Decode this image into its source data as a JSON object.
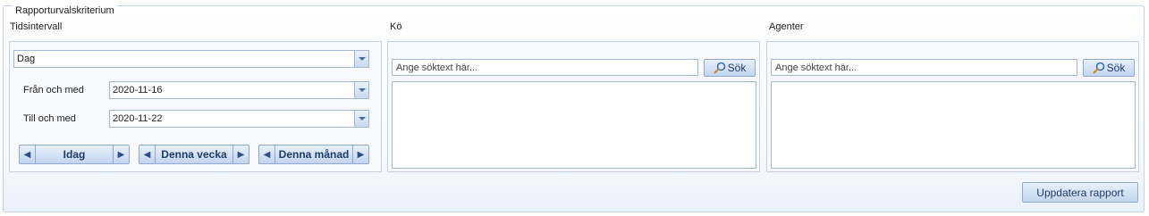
{
  "group_title": "Rapporturvalskriterium",
  "time": {
    "label": "Tidsintervall",
    "interval_value": "Dag",
    "from_label": "Från och med",
    "from_value": "2020-11-16",
    "to_label": "Till och med",
    "to_value": "2020-11-22",
    "nav_today": "Idag",
    "nav_week": "Denna vecka",
    "nav_month": "Denna månad"
  },
  "queue": {
    "label": "Kö",
    "search_placeholder": "Ange söktext här...",
    "search_button": "Sök"
  },
  "agents": {
    "label": "Agenter",
    "search_placeholder": "Ange söktext här...",
    "search_button": "Sök"
  },
  "update_button": "Uppdatera rapport",
  "icons": {
    "search": "magnifier-icon",
    "arrow_left": "arrow-left-icon",
    "arrow_right": "arrow-right-icon",
    "dropdown": "chevron-down-icon"
  }
}
